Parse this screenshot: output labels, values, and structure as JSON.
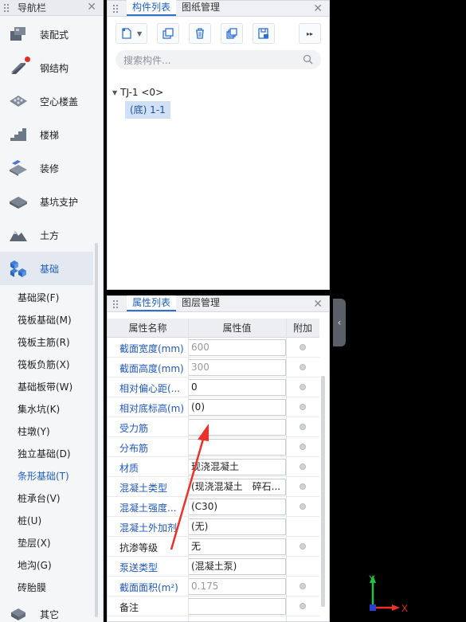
{
  "nav": {
    "title": "导航栏",
    "categories": [
      {
        "label": "装配式"
      },
      {
        "label": "钢结构"
      },
      {
        "label": "空心楼盖"
      },
      {
        "label": "楼梯"
      },
      {
        "label": "装修"
      },
      {
        "label": "基坑支护"
      },
      {
        "label": "土方"
      },
      {
        "label": "基础"
      },
      {
        "label": "其它"
      }
    ],
    "sub_items": [
      "基础梁(F)",
      "筏板基础(M)",
      "筏板主筋(R)",
      "筏板负筋(X)",
      "基础板带(W)",
      "集水坑(K)",
      "柱墩(Y)",
      "独立基础(D)",
      "条形基础(T)",
      "桩承台(V)",
      "桩(U)",
      "垫层(X)",
      "地沟(G)",
      "砖胎膜"
    ],
    "active_sub": "条形基础(T)"
  },
  "component_panel": {
    "tabs": [
      "构件列表",
      "图纸管理"
    ],
    "search_placeholder": "搜索构件...",
    "tree_root": "TJ-1 <0>",
    "tree_child": "(底) 1-1"
  },
  "property_panel": {
    "tabs": [
      "属性列表",
      "图层管理"
    ],
    "headers": {
      "name": "属性名称",
      "value": "属性值",
      "extra": "附加"
    },
    "rows": [
      {
        "name": "截面宽度(mm)",
        "value": "600",
        "name_color": "blue",
        "value_gray": true,
        "dot": true
      },
      {
        "name": "截面高度(mm)",
        "value": "300",
        "name_color": "blue",
        "value_gray": true,
        "dot": true
      },
      {
        "name": "相对偏心距(...",
        "value": "0",
        "name_color": "blue",
        "value_gray": false,
        "dot": true
      },
      {
        "name": "相对底标高(m)",
        "value": "(0)",
        "name_color": "blue",
        "value_gray": false,
        "dot": true
      },
      {
        "name": "受力筋",
        "value": "",
        "name_color": "blue",
        "value_gray": false,
        "dot": true
      },
      {
        "name": "分布筋",
        "value": "",
        "name_color": "blue",
        "value_gray": false,
        "dot": true
      },
      {
        "name": "材质",
        "value": "现浇混凝土",
        "name_color": "blue",
        "value_gray": false,
        "dot": true
      },
      {
        "name": "混凝土类型",
        "value": "(现浇混凝土　碎石...",
        "name_color": "blue",
        "value_gray": false,
        "dot": true
      },
      {
        "name": "混凝土强度...",
        "value": "(C30)",
        "name_color": "blue",
        "value_gray": false,
        "dot": true
      },
      {
        "name": "混凝土外加剂",
        "value": "(无)",
        "name_color": "blue",
        "value_gray": false,
        "dot": false
      },
      {
        "name": "抗渗等级",
        "value": "无",
        "name_color": "black",
        "value_gray": false,
        "dot": true
      },
      {
        "name": "泵送类型",
        "value": "(混凝土泵)",
        "name_color": "blue",
        "value_gray": false,
        "dot": false
      },
      {
        "name": "截面面积(m²)",
        "value": "0.175",
        "name_color": "blue",
        "value_gray": true,
        "dot": true
      },
      {
        "name": "备注",
        "value": "",
        "name_color": "black",
        "value_gray": false,
        "dot": true
      }
    ]
  },
  "axis": {
    "x_label": "X",
    "y_label": "Y"
  },
  "colors": {
    "accent": "#2f6fcf",
    "selected_bg": "#cfe0f7",
    "annotation_arrow": "#e8322b"
  }
}
